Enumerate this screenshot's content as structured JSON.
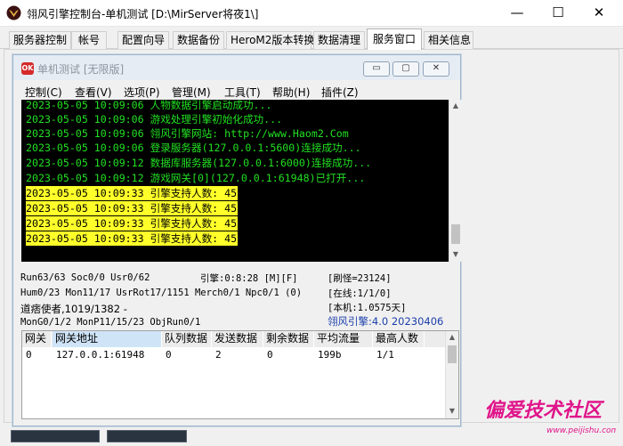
{
  "window": {
    "title": "翎风引擎控制台-单机测试 [D:\\MirServer将夜1\\]",
    "minimize": "—",
    "maximize": "☐",
    "close": "✕"
  },
  "tabs": [
    "服务器控制",
    "帐号",
    "配置向导",
    "数据备份",
    "HeroM2版本转换",
    "数据清理",
    "服务窗口",
    "相关信息"
  ],
  "active_tab": "服务窗口",
  "inner_window": {
    "title": "单机测试 [无限版]",
    "icon_text": "OK",
    "menu": [
      "控制(C)",
      "查看(V)",
      "选项(P)",
      "管理(M)",
      "工具(T)",
      "帮助(H)",
      "插件(Z)"
    ],
    "minimize": "▭",
    "maximize": "▢",
    "close": "✕"
  },
  "log": [
    {
      "text": "2023-05-05 10:09:06 人物数据引擎启动成功...",
      "hl": false
    },
    {
      "text": "2023-05-05 10:09:06 游戏处理引擎初始化成功...",
      "hl": false
    },
    {
      "text": "2023-05-05 10:09:06 翎风引擎网站: http://www.Haom2.Com",
      "hl": false
    },
    {
      "text": "2023-05-05 10:09:06 登录服务器(127.0.0.1:5600)连接成功...",
      "hl": false
    },
    {
      "text": "2023-05-05 10:09:12 数据库服务器(127.0.0.1:6000)连接成功...",
      "hl": false
    },
    {
      "text": "2023-05-05 10:09:12 游戏网关[0](127.0.0.1:61948)已打开...",
      "hl": false
    },
    {
      "text": "2023-05-05 10:09:33 引擎支持人数: 45",
      "hl": true
    },
    {
      "text": "2023-05-05 10:09:33 引擎支持人数: 45",
      "hl": true
    },
    {
      "text": "2023-05-05 10:09:33 引擎支持人数: 45",
      "hl": true
    },
    {
      "text": "2023-05-05 10:09:33 引擎支持人数: 45",
      "hl": true
    }
  ],
  "status": {
    "line1_left": "Run63/63 Soc0/0 Usr0/62",
    "line1_mid": "引擎:0:8:28 [M][F]",
    "line1_right": "[刷怪=23124]",
    "line2_left": "Hum0/23 Mon11/17 UsrRot17/1151 Merch0/1 Npc0/1 (0)",
    "line2_right": "[在线:1/1/0]",
    "line3_left": "道痞使者,1019/1382 -",
    "line3_right": "[本机:1.0575天]",
    "line4_left": "MonG0/1/2 MonP11/15/23 ObjRun0/1",
    "line4_right": "翎风引擎:4.0 20230406"
  },
  "gateway_table": {
    "headers": [
      "网关",
      "网关地址",
      "队列数据",
      "发送数据",
      "剩余数据",
      "平均流量",
      "最高人数"
    ],
    "rows": [
      [
        "0",
        "127.0.0.1:61948",
        "0",
        "2",
        "0",
        "199b",
        "1/1"
      ]
    ]
  },
  "watermark": {
    "text": "偏爱技术社区",
    "url": "www.peijishu.com",
    "color": "#e0148a"
  },
  "colors": {
    "log_text": "#22e022",
    "log_highlight": "#ffff2a",
    "log_bg": "#000000",
    "status_blue": "#1c3faa"
  }
}
